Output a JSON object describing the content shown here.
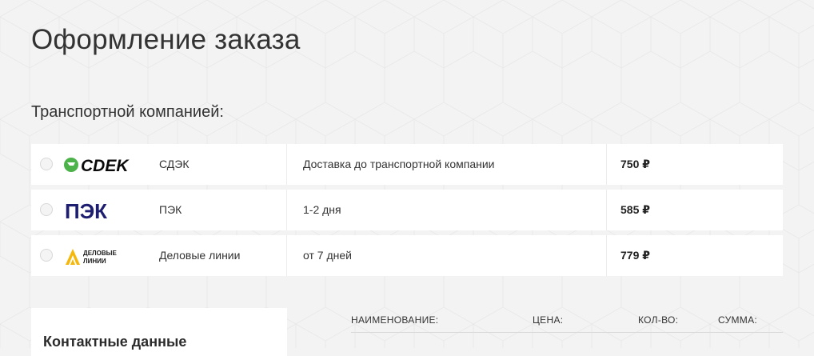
{
  "page": {
    "title": "Оформление заказа"
  },
  "delivery": {
    "section_title": "Транспортной компанией:",
    "carriers": [
      {
        "logo": "СDЭК",
        "name": "СДЭК",
        "term": "Доставка до транспортной компании",
        "price": "750 ₽",
        "logo_color": "#0a0a0a",
        "logo_accent": "#4cb24a"
      },
      {
        "logo": "ПЭК",
        "name": "ПЭК",
        "term": "1-2 дня",
        "price": "585 ₽",
        "logo_color": "#1d1e6f"
      },
      {
        "logo": "ДЕЛОВЫЕ ЛИНИИ",
        "name": "Деловые линии",
        "term": "от 7 дней",
        "price": "779 ₽",
        "logo_color": "#1a1a1a",
        "logo_accent": "#f5b70a"
      }
    ]
  },
  "contacts": {
    "title": "Контактные данные"
  },
  "order_table": {
    "columns": [
      "НАИМЕНОВАНИЕ:",
      "ЦЕНА:",
      "КОЛ-ВО:",
      "СУММА:"
    ]
  }
}
